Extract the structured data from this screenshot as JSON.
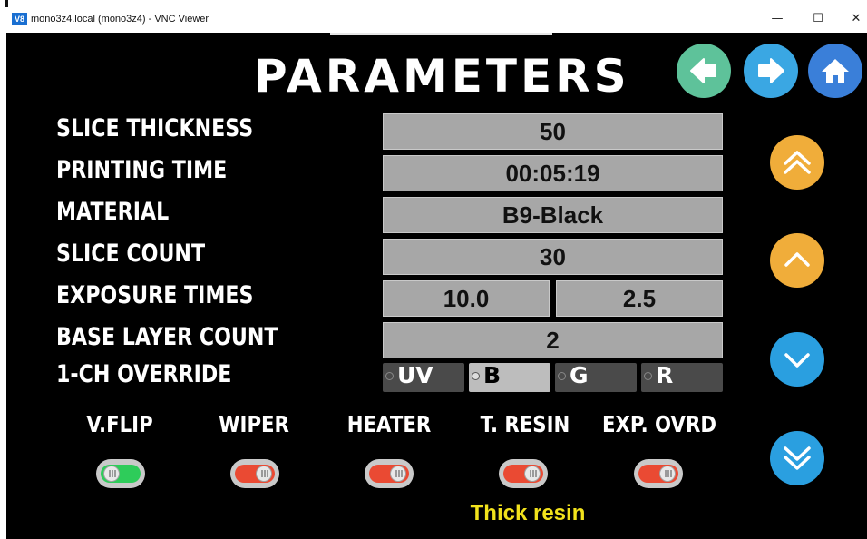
{
  "window": {
    "app_icon": "V8",
    "title": "mono3z4.local (mono3z4) - VNC Viewer",
    "minimize": "—",
    "maximize": "☐",
    "close": "✕"
  },
  "screen": {
    "title": "PARAMETERS",
    "nav": {
      "back_icon": "arrow-left-icon",
      "forward_icon": "arrow-right-icon",
      "home_icon": "home-icon"
    },
    "params": {
      "slice_thickness": {
        "label": "SLICE THICKNESS",
        "value": "50"
      },
      "printing_time": {
        "label": "PRINTING TIME",
        "value": "00:05:19"
      },
      "material": {
        "label": "MATERIAL",
        "value": "B9-Black"
      },
      "slice_count": {
        "label": "SLICE COUNT",
        "value": "30"
      },
      "exposure_times": {
        "label": "EXPOSURE TIMES",
        "value_1": "10.0",
        "value_2": "2.5"
      },
      "base_layer_count": {
        "label": "BASE LAYER COUNT",
        "value": "2"
      },
      "override": {
        "label": "1-CH OVERRIDE",
        "options": [
          "UV",
          "B",
          "G",
          "R"
        ],
        "selected": "B"
      }
    },
    "toggles": [
      {
        "label": "V.FLIP",
        "state": "on"
      },
      {
        "label": "WIPER",
        "state": "off"
      },
      {
        "label": "HEATER",
        "state": "off"
      },
      {
        "label": "T. RESIN",
        "state": "off"
      },
      {
        "label": "EXP. OVRD",
        "state": "off"
      }
    ],
    "status_text": "Thick resin",
    "scroll": {
      "page_up_icon": "double-chevron-up-icon",
      "up_icon": "chevron-up-icon",
      "down_icon": "chevron-down-icon",
      "page_down_icon": "double-chevron-down-icon"
    }
  },
  "colors": {
    "nav_back": "#5ec29a",
    "nav_forward": "#3aa7e3",
    "nav_home": "#3a7fd9",
    "scroll_up": "#f0ad3a",
    "scroll_down": "#2a9fe0",
    "field_bg": "#a7a7a7",
    "toggle_on": "#2ecc5a",
    "toggle_off": "#ea4a33",
    "status_text": "#f2e21c"
  }
}
